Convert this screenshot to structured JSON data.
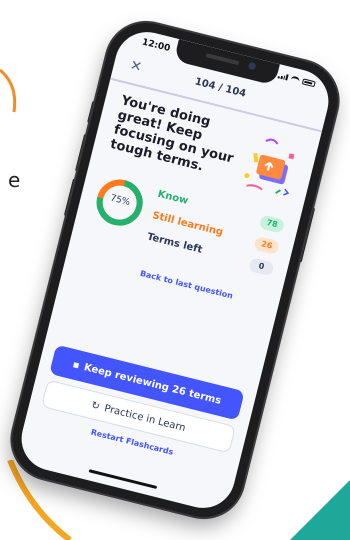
{
  "status_bar": {
    "time": "12:00"
  },
  "header": {
    "progress": "104 / 104"
  },
  "summary": {
    "headline": "You're doing great! Keep focusing on your tough terms.",
    "percent_label": "75%",
    "percent_value": 75
  },
  "stats": [
    {
      "label": "Know",
      "count": "78",
      "color": "#23b26d",
      "badge_bg": "#c7f2de"
    },
    {
      "label": "Still learning",
      "count": "26",
      "color": "#ff7a1a",
      "badge_bg": "#ffe3cc"
    },
    {
      "label": "Terms left",
      "count": "0",
      "color": "#2e3856",
      "badge_bg": "#e7e9f2"
    }
  ],
  "links": {
    "back": "Back to last question",
    "restart": "Restart Flashcards"
  },
  "actions": {
    "primary": "Keep reviewing 26 terms",
    "secondary": "Practice in Learn"
  },
  "background": {
    "partial_text": "e"
  },
  "colors": {
    "accent": "#4255ff",
    "know": "#23b26d",
    "learning": "#ff7a1a"
  }
}
